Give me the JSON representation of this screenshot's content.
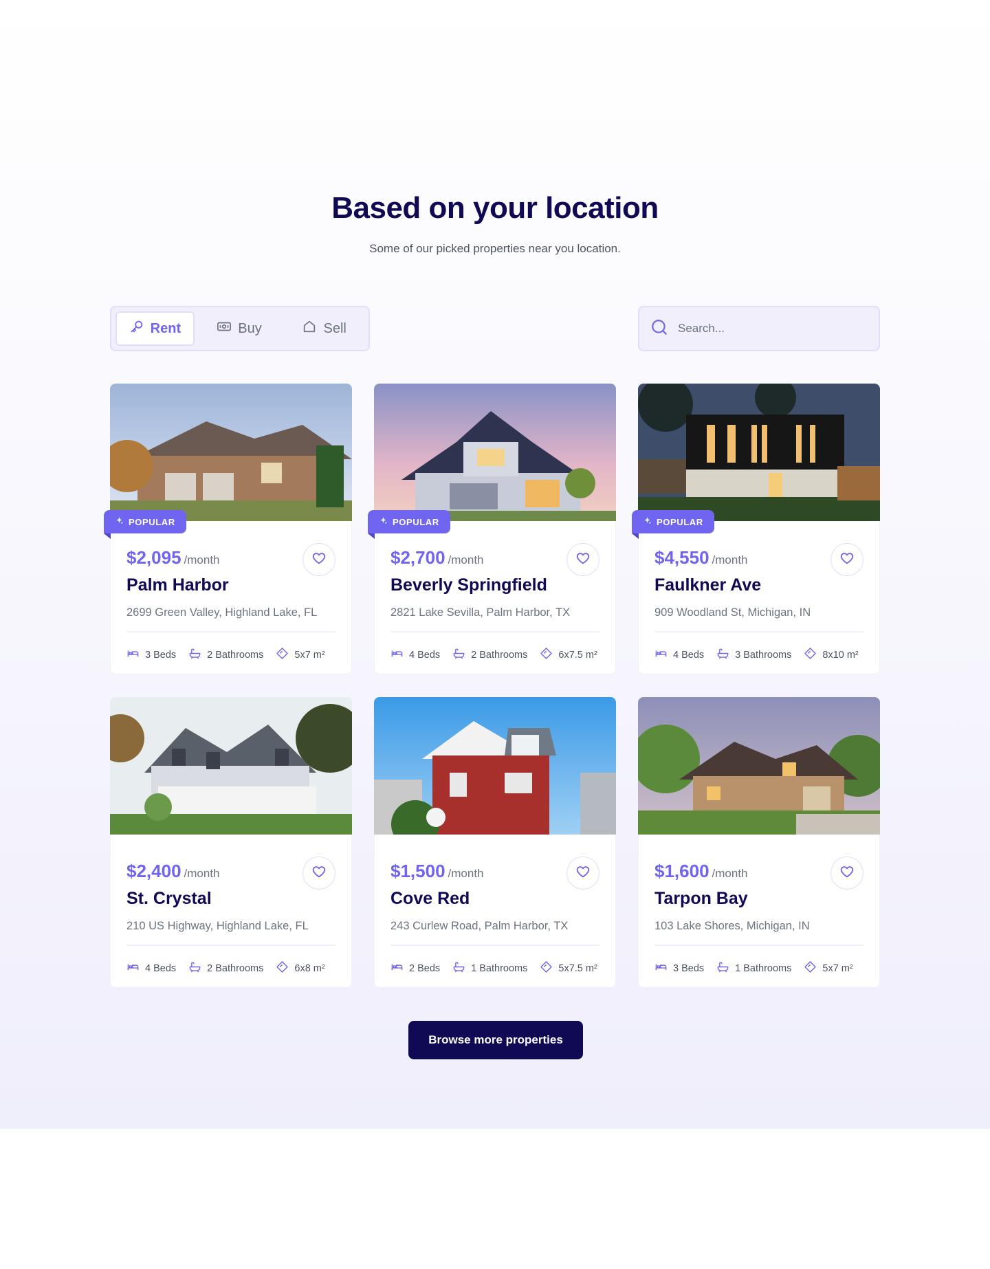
{
  "header": {
    "title": "Based on your location",
    "subtitle": "Some of our picked properties near you location."
  },
  "tabs": [
    {
      "label": "Rent",
      "icon": "key-icon",
      "active": true
    },
    {
      "label": "Buy",
      "icon": "cash-icon",
      "active": false
    },
    {
      "label": "Sell",
      "icon": "home-icon",
      "active": false
    }
  ],
  "search": {
    "placeholder": "Search...",
    "value": "",
    "icon": "search-icon"
  },
  "colors": {
    "accent": "#7065F0",
    "dark": "#100A55",
    "muted": "#6C727F",
    "border": "#E0DEFC"
  },
  "badge_label": "POPULAR",
  "price_unit": "/month",
  "properties": [
    {
      "price": "$2,095",
      "name": "Palm Harbor",
      "address": "2699 Green Valley, Highland Lake, FL",
      "beds": "3 Beds",
      "baths": "2 Bathrooms",
      "area": "5x7 m²",
      "popular": true
    },
    {
      "price": "$2,700",
      "name": "Beverly Springfield",
      "address": "2821 Lake Sevilla, Palm Harbor, TX",
      "beds": "4 Beds",
      "baths": "2 Bathrooms",
      "area": "6x7.5 m²",
      "popular": true
    },
    {
      "price": "$4,550",
      "name": "Faulkner Ave",
      "address": "909 Woodland St, Michigan, IN",
      "beds": "4 Beds",
      "baths": "3 Bathrooms",
      "area": "8x10 m²",
      "popular": true
    },
    {
      "price": "$2,400",
      "name": "St. Crystal",
      "address": "210 US Highway, Highland Lake, FL",
      "beds": "4 Beds",
      "baths": "2 Bathrooms",
      "area": "6x8 m²",
      "popular": false
    },
    {
      "price": "$1,500",
      "name": "Cove Red",
      "address": "243 Curlew Road, Palm Harbor, TX",
      "beds": "2 Beds",
      "baths": "1 Bathrooms",
      "area": "5x7.5 m²",
      "popular": false
    },
    {
      "price": "$1,600",
      "name": "Tarpon Bay",
      "address": "103 Lake Shores, Michigan, IN",
      "beds": "3 Beds",
      "baths": "1 Bathrooms",
      "area": "5x7 m²",
      "popular": false
    }
  ],
  "cta": {
    "label": "Browse more properties"
  }
}
